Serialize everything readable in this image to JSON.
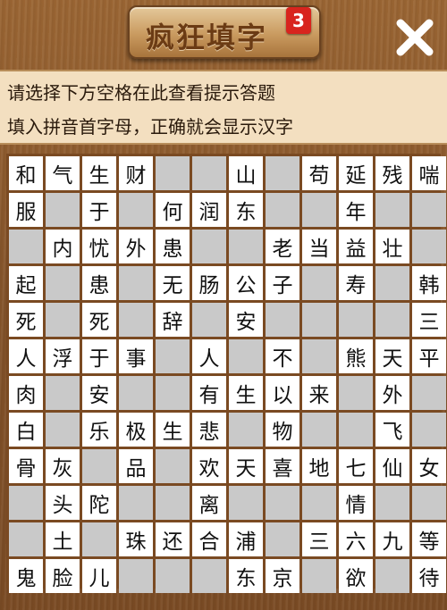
{
  "header": {
    "title": "疯狂填字",
    "level": "3",
    "close_glyph": "✕"
  },
  "hint": {
    "line1": "请选择下方空格在此查看提示答题",
    "line2": "填入拼音首字母，正确就会显示汉字"
  },
  "grid": [
    [
      "和",
      "气",
      "生",
      "财",
      "",
      "",
      "山",
      "",
      "苟",
      "延",
      "残",
      "喘"
    ],
    [
      "服",
      "",
      "于",
      "",
      "何",
      "润",
      "东",
      "",
      "",
      "年",
      "",
      ""
    ],
    [
      "",
      "内",
      "忧",
      "外",
      "患",
      "",
      "",
      "老",
      "当",
      "益",
      "壮",
      ""
    ],
    [
      "起",
      "",
      "患",
      "",
      "无",
      "肠",
      "公",
      "子",
      "",
      "寿",
      "",
      "韩"
    ],
    [
      "死",
      "",
      "死",
      "",
      "辞",
      "",
      "安",
      "",
      "",
      "",
      "",
      "三"
    ],
    [
      "人",
      "浮",
      "于",
      "事",
      "",
      "人",
      "",
      "不",
      "",
      "熊",
      "天",
      "平"
    ],
    [
      "肉",
      "",
      "安",
      "",
      "",
      "有",
      "生",
      "以",
      "来",
      "",
      "外",
      ""
    ],
    [
      "白",
      "",
      "乐",
      "极",
      "生",
      "悲",
      "",
      "物",
      "",
      "",
      "飞",
      ""
    ],
    [
      "骨",
      "灰",
      "",
      "品",
      "",
      "欢",
      "天",
      "喜",
      "地",
      "七",
      "仙",
      "女"
    ],
    [
      "",
      "头",
      "陀",
      "",
      "",
      "离",
      "",
      "",
      "",
      "情",
      "",
      ""
    ],
    [
      "",
      "土",
      "",
      "珠",
      "还",
      "合",
      "浦",
      "",
      "三",
      "六",
      "九",
      "等"
    ],
    [
      "鬼",
      "脸",
      "儿",
      "",
      "",
      "",
      "东",
      "京",
      "",
      "欲",
      "",
      "待"
    ]
  ]
}
